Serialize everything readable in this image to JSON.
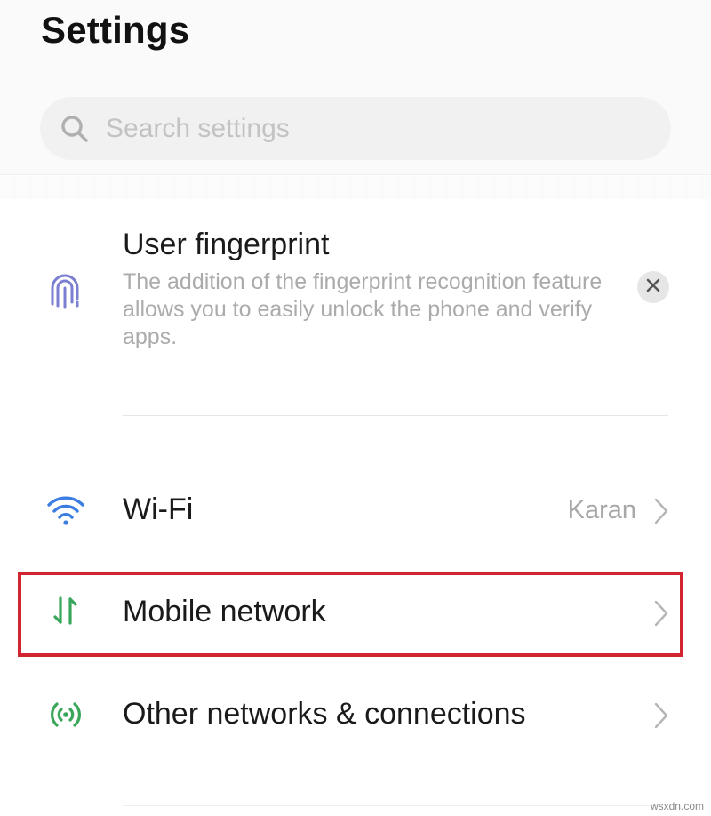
{
  "header": {
    "title": "Settings"
  },
  "search": {
    "placeholder": "Search settings",
    "value": "",
    "icon": "search-icon"
  },
  "suggestion_card": {
    "title": "User fingerprint",
    "description": "The addition of the fingerprint recognition feature allows you to easily unlock the phone and verify apps.",
    "icon": "fingerprint-icon",
    "dismiss_icon": "close-icon",
    "icon_color": "#7b7fd1"
  },
  "items": [
    {
      "label": "Wi-Fi",
      "value": "Karan",
      "icon": "wifi-icon",
      "icon_color": "#3b7de0"
    },
    {
      "label": "Mobile network",
      "value": "",
      "icon": "mobile-data-icon",
      "icon_color": "#3aa65a",
      "highlighted": true
    },
    {
      "label": "Other networks & connections",
      "value": "",
      "icon": "connections-icon",
      "icon_color": "#3aa65a"
    }
  ],
  "highlight_color": "#d1262f",
  "watermark": "wsxdn.com"
}
